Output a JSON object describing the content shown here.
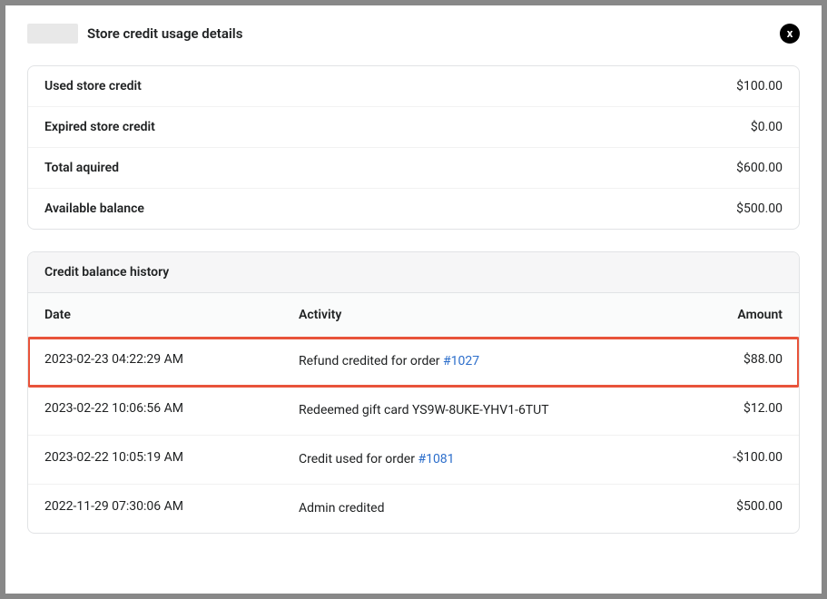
{
  "modal": {
    "title": "Store credit usage details"
  },
  "summary": {
    "rows": [
      {
        "label": "Used store credit",
        "value": "$100.00"
      },
      {
        "label": "Expired store credit",
        "value": "$0.00"
      },
      {
        "label": "Total aquired",
        "value": "$600.00"
      },
      {
        "label": "Available balance",
        "value": "$500.00"
      }
    ]
  },
  "history": {
    "title": "Credit balance history",
    "columns": {
      "date": "Date",
      "activity": "Activity",
      "amount": "Amount"
    },
    "rows": [
      {
        "date": "2023-02-23 04:22:29 AM",
        "activity_prefix": "Refund credited for order ",
        "order_link": "#1027",
        "activity_suffix": "",
        "amount": "$88.00",
        "highlighted": true
      },
      {
        "date": "2023-02-22 10:06:56 AM",
        "activity_prefix": "Redeemed gift card YS9W-8UKE-YHV1-6TUT",
        "order_link": "",
        "activity_suffix": "",
        "amount": "$12.00",
        "highlighted": false
      },
      {
        "date": "2023-02-22 10:05:19 AM",
        "activity_prefix": "Credit used for order ",
        "order_link": "#1081",
        "activity_suffix": "",
        "amount": "-$100.00",
        "highlighted": false
      },
      {
        "date": "2022-11-29 07:30:06 AM",
        "activity_prefix": "Admin credited",
        "order_link": "",
        "activity_suffix": "",
        "amount": "$500.00",
        "highlighted": false
      }
    ]
  }
}
